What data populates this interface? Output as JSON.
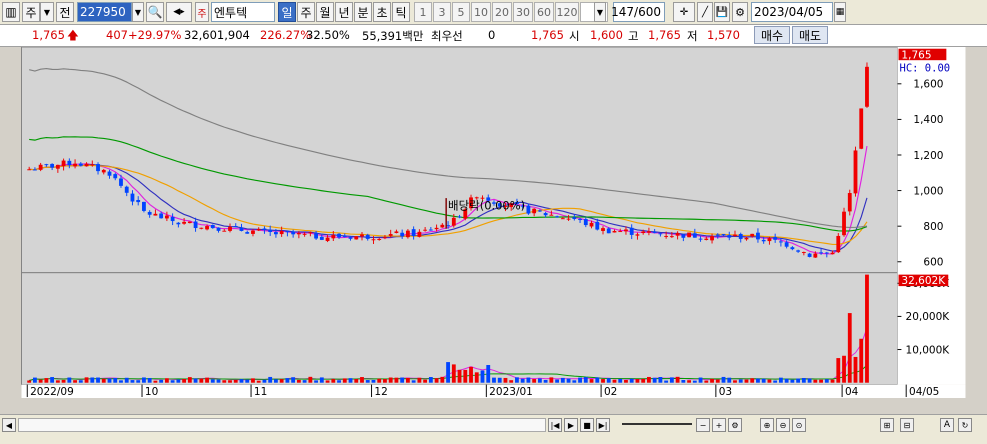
{
  "toolbar": {
    "market_buttons": [
      "주",
      "전"
    ],
    "stock_code": "227950",
    "stock_name": "엔투텍",
    "period_tabs": [
      "일",
      "주",
      "월",
      "년",
      "분",
      "초",
      "틱"
    ],
    "active_period": "일",
    "intervals": [
      "1",
      "3",
      "5",
      "10",
      "20",
      "30",
      "60",
      "120"
    ],
    "count": "147/600",
    "date": "2023/04/05"
  },
  "quote": {
    "price": "1,765",
    "change": "407",
    "change_pct": "+29.97%",
    "volume": "32,601,904",
    "volume_ratio": "226.27%",
    "turnover": "32.50%",
    "amount": "55,391백만",
    "priority_label": "최우선",
    "priority_value": "0",
    "last": "1,765",
    "open_label": "시",
    "open": "1,600",
    "high_label": "고",
    "high": "1,765",
    "low_label": "저",
    "low": "1,570",
    "buy_label": "매수",
    "sell_label": "매도"
  },
  "chart_data": {
    "type": "candlestick",
    "price_axis_ticks": [
      "1,600",
      "1,400",
      "1,200",
      "1,000",
      "800",
      "600"
    ],
    "price_range": [
      560,
      1780
    ],
    "current_price_label": "1,765",
    "hc_label": "HC: 0.00",
    "annotation": "배당락(0.00%)",
    "volume_axis_ticks": [
      "30,000K",
      "20,000K",
      "10,000K"
    ],
    "volume_range": [
      0,
      32602
    ],
    "current_volume_label": "32,602K",
    "x_labels": [
      "2022/09",
      "10",
      "11",
      "12",
      "2023/01",
      "02",
      "03",
      "04",
      "04/05"
    ],
    "colors": {
      "up": "#f00000",
      "down": "#0044ff",
      "ma5": "#e020e0",
      "ma10": "#3030c0",
      "ma20": "#f0a000",
      "ma60": "#009900",
      "ma120": "#808080"
    }
  },
  "scroll": {
    "controls": [
      "◀",
      "▶",
      "■",
      "▶▶"
    ]
  }
}
